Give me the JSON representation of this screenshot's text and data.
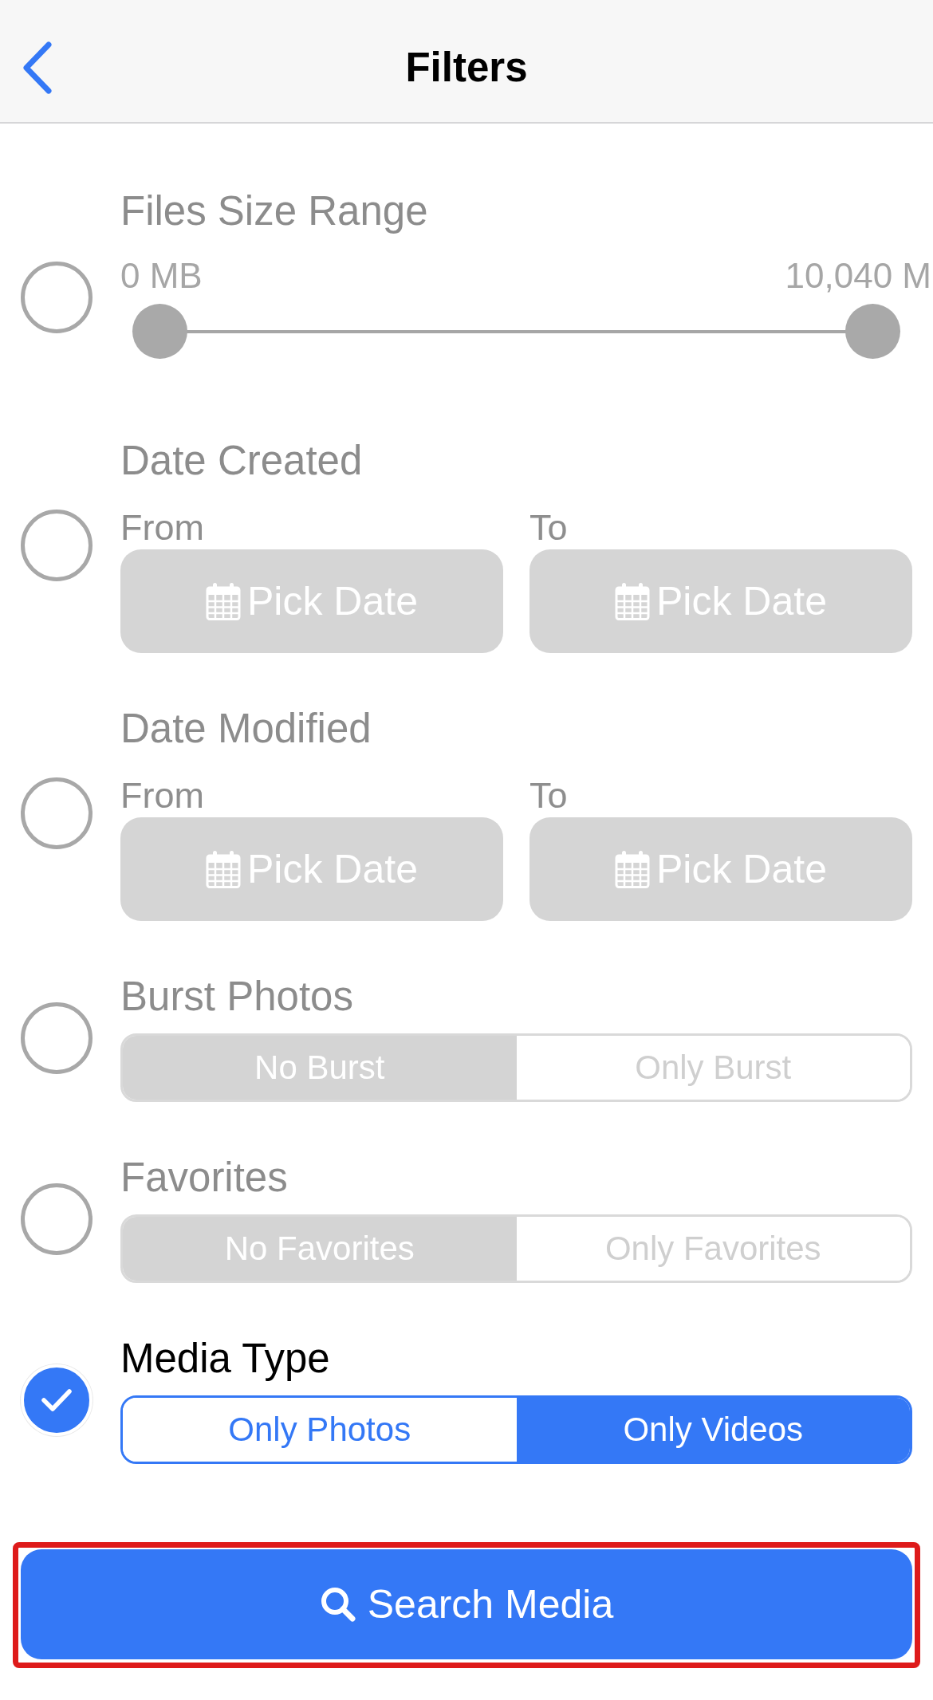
{
  "nav": {
    "title": "Filters"
  },
  "filters": [
    {
      "kind": "range",
      "title": "Files Size Range",
      "checked": false,
      "min_label": "0 MB",
      "max_label": "10,040 M",
      "thumbs": [
        {
          "level": 0
        },
        {
          "level": 1
        }
      ]
    },
    {
      "kind": "dates",
      "title": "Date Created",
      "checked": false,
      "fields": [
        {
          "label": "From",
          "button": "Pick Date"
        },
        {
          "label": "To",
          "button": "Pick Date"
        }
      ]
    },
    {
      "kind": "dates",
      "title": "Date Modified",
      "checked": false,
      "fields": [
        {
          "label": "From",
          "button": "Pick Date"
        },
        {
          "label": "To",
          "button": "Pick Date"
        }
      ]
    },
    {
      "kind": "segments",
      "title": "Burst Photos",
      "checked": false,
      "options": [
        {
          "label": "No Burst",
          "selected": true
        },
        {
          "label": "Only Burst",
          "selected": false
        }
      ]
    },
    {
      "kind": "segments",
      "title": "Favorites",
      "checked": false,
      "options": [
        {
          "label": "No Favorites",
          "selected": true
        },
        {
          "label": "Only Favorites",
          "selected": false
        }
      ]
    },
    {
      "kind": "segments",
      "title": "Media Type",
      "checked": true,
      "options": [
        {
          "label": "Only Photos",
          "selected": false
        },
        {
          "label": "Only Videos",
          "selected": true
        }
      ]
    }
  ],
  "search_button": {
    "label": "Search Media",
    "highlighted": true
  }
}
